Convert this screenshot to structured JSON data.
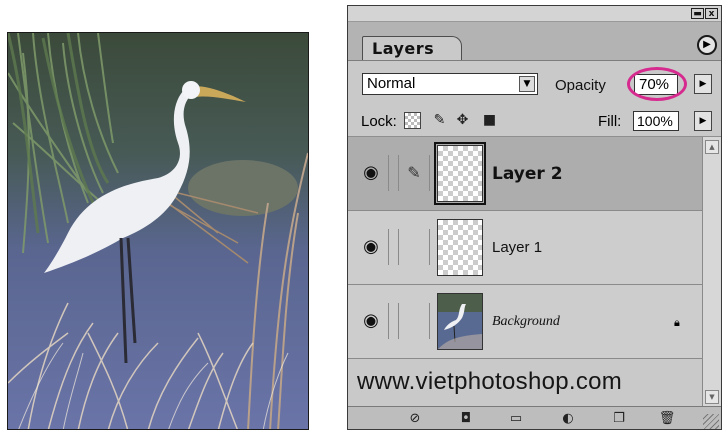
{
  "photo": {
    "subject": "egret-photo"
  },
  "panel": {
    "window_buttons": [
      "▬",
      "x"
    ],
    "tab_label": "Layers",
    "menu_icon": "menu-arrow-icon",
    "blend_mode": "Normal",
    "opacity_label": "Opacity",
    "opacity_value": "70%",
    "lock_label": "Lock:",
    "fill_label": "Fill:",
    "fill_value": "100%",
    "layers": [
      {
        "name": "Layer 2",
        "visible": true,
        "selected": true
      },
      {
        "name": "Layer 1",
        "visible": true,
        "selected": false
      },
      {
        "name": "Background",
        "visible": true,
        "selected": false,
        "locked": true
      }
    ],
    "watermark": "www.vietphotoshop.com",
    "highlight_color": "#d62a8f"
  }
}
